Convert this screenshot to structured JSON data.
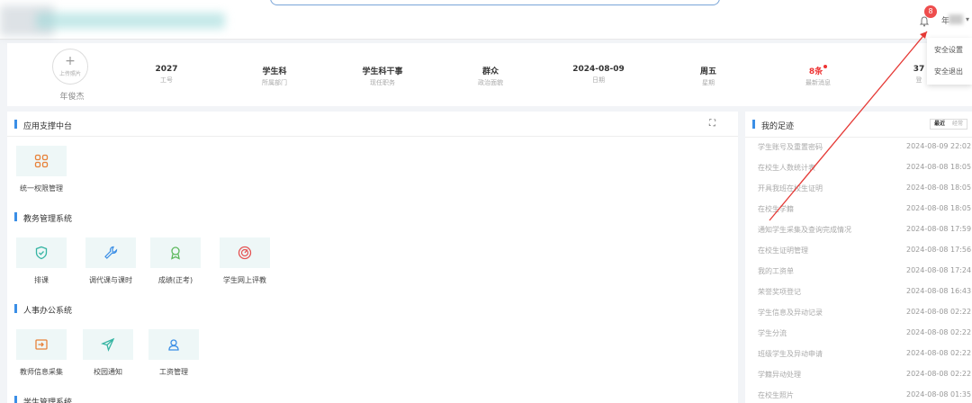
{
  "header": {
    "badge_count": "8",
    "user_name_prefix": "年",
    "menu": [
      "安全设置",
      "安全退出"
    ]
  },
  "profile": {
    "upload_label": "上传照片",
    "name": "年俊杰",
    "fields": [
      {
        "value": "2027",
        "label": "工号"
      },
      {
        "value": "学生科",
        "label": "所属部门"
      },
      {
        "value": "学生科干事",
        "label": "现任职务"
      },
      {
        "value": "群众",
        "label": "政治面貌"
      },
      {
        "value": "2024-08-09",
        "label": "日期"
      },
      {
        "value": "周五",
        "label": "星期"
      },
      {
        "value": "8条",
        "label": "最新消息"
      },
      {
        "value": "37",
        "label": "登"
      }
    ]
  },
  "left_panel": {
    "title": "应用支撑中台",
    "sections": [
      {
        "title": "",
        "tiles": [
          {
            "label": "统一权限管理",
            "icon": "grid-apps-icon"
          }
        ]
      },
      {
        "title": "教务管理系统",
        "tiles": [
          {
            "label": "排课",
            "icon": "shield-check-icon"
          },
          {
            "label": "调代课与课时",
            "icon": "wrench-icon"
          },
          {
            "label": "成绩(正考)",
            "icon": "award-icon"
          },
          {
            "label": "学生网上评教",
            "icon": "gauge-icon"
          }
        ]
      },
      {
        "title": "人事办公系统",
        "tiles": [
          {
            "label": "教师信息采集",
            "icon": "login-box-icon"
          },
          {
            "label": "校园通知",
            "icon": "send-icon"
          },
          {
            "label": "工资管理",
            "icon": "user-location-icon"
          }
        ]
      },
      {
        "title": "学生管理系统",
        "tiles": []
      }
    ]
  },
  "right_panel": {
    "title": "我的足迹",
    "toggle": [
      "最近",
      "经常"
    ],
    "items": [
      {
        "name": "学生账号及重置密码",
        "time": "2024-08-09 22:02"
      },
      {
        "name": "在校生人数统计表",
        "time": "2024-08-08 18:05"
      },
      {
        "name": "开具我班在校生证明",
        "time": "2024-08-08 18:05"
      },
      {
        "name": "在校生学籍",
        "time": "2024-08-08 18:05"
      },
      {
        "name": "通知学生采集及查询完成情况",
        "time": "2024-08-08 17:59"
      },
      {
        "name": "在校生证明管理",
        "time": "2024-08-08 17:56"
      },
      {
        "name": "我的工资单",
        "time": "2024-08-08 17:24"
      },
      {
        "name": "荣誉奖项登记",
        "time": "2024-08-08 16:43"
      },
      {
        "name": "学生信息及异动记录",
        "time": "2024-08-08 02:22"
      },
      {
        "name": "学生分流",
        "time": "2024-08-08 02:22"
      },
      {
        "name": "班级学生及异动申请",
        "time": "2024-08-08 02:22"
      },
      {
        "name": "学籍异动处理",
        "time": "2024-08-08 02:22"
      },
      {
        "name": "在校生照片",
        "time": "2024-08-08 01:35"
      }
    ]
  },
  "colors": {
    "accent": "#3a8ee6",
    "badge": "#ee4d4d",
    "annotation": "#e53935",
    "tile_bg": "#eef7f7"
  }
}
